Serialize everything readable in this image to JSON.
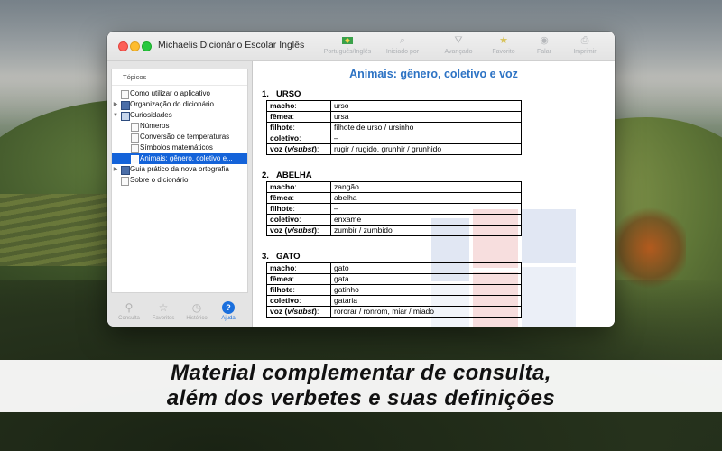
{
  "window": {
    "title": "Michaelis Dicionário Escolar Inglês",
    "toolbar": [
      {
        "label": "Português/Inglês",
        "icon": "flag-icon"
      },
      {
        "label": "Iniciado por",
        "icon": "search-prefix-icon"
      },
      {
        "label": "Avançado",
        "icon": "advanced-icon"
      },
      {
        "label": "Favorito",
        "icon": "star-icon"
      },
      {
        "label": "Falar",
        "icon": "speaker-icon"
      },
      {
        "label": "Imprimir",
        "icon": "printer-icon"
      }
    ]
  },
  "sidebar": {
    "header": "Tópicos",
    "items": [
      {
        "label": "Como utilizar o aplicativo",
        "indent": 0,
        "icon": "doc",
        "arrow": ""
      },
      {
        "label": "Organização do dicionário",
        "indent": 0,
        "icon": "book",
        "arrow": "▶"
      },
      {
        "label": "Curiosidades",
        "indent": 0,
        "icon": "book-open",
        "arrow": "▼"
      },
      {
        "label": "Números",
        "indent": 1,
        "icon": "doc",
        "arrow": ""
      },
      {
        "label": "Conversão de temperaturas",
        "indent": 1,
        "icon": "doc",
        "arrow": ""
      },
      {
        "label": "Símbolos matemáticos",
        "indent": 1,
        "icon": "doc",
        "arrow": ""
      },
      {
        "label": "Animais: gênero, coletivo e...",
        "indent": 1,
        "icon": "doc",
        "arrow": "",
        "selected": true
      },
      {
        "label": "Guia prático da nova ortografia",
        "indent": 0,
        "icon": "book",
        "arrow": "▶"
      },
      {
        "label": "Sobre o dicionário",
        "indent": 0,
        "icon": "doc",
        "arrow": ""
      }
    ],
    "tabs": [
      {
        "label": "Consulta",
        "icon": "magnifier-icon",
        "active": false
      },
      {
        "label": "Favoritos",
        "icon": "star-icon",
        "active": false
      },
      {
        "label": "Histórico",
        "icon": "clock-icon",
        "active": false
      },
      {
        "label": "Ajuda",
        "icon": "help-icon",
        "active": true
      }
    ]
  },
  "content": {
    "title": "Animais: gênero, coletivo e voz",
    "sections": [
      {
        "number": "1.",
        "name": "URSO",
        "rows": [
          {
            "key": "macho",
            "value": "urso"
          },
          {
            "key": "fêmea",
            "value": "ursa"
          },
          {
            "key": "filhote",
            "value": "filhote de urso / ursinho"
          },
          {
            "key": "coletivo",
            "value": "–"
          },
          {
            "key": "voz (v/subst)",
            "value": "rugir / rugido, grunhir / grunhido"
          }
        ]
      },
      {
        "number": "2.",
        "name": "ABELHA",
        "rows": [
          {
            "key": "macho",
            "value": "zangão"
          },
          {
            "key": "fêmea",
            "value": "abelha"
          },
          {
            "key": "filhote",
            "value": "–"
          },
          {
            "key": "coletivo",
            "value": "enxame"
          },
          {
            "key": "voz (v/subst)",
            "value": "zumbir / zumbido"
          }
        ]
      },
      {
        "number": "3.",
        "name": "GATO",
        "rows": [
          {
            "key": "macho",
            "value": "gato"
          },
          {
            "key": "fêmea",
            "value": "gata"
          },
          {
            "key": "filhote",
            "value": "gatinho"
          },
          {
            "key": "coletivo",
            "value": "gataria"
          },
          {
            "key": "voz (v/subst)",
            "value": "rororar / ronrom, miar / miado"
          }
        ]
      }
    ]
  },
  "caption": {
    "line1": "Material complementar de consulta,",
    "line2": "além dos verbetes e suas definições"
  },
  "colors": {
    "accent": "#2d73c4",
    "selection": "#1463d9",
    "close": "#fd5f57",
    "minimize": "#febc2e",
    "maximize": "#28c840"
  }
}
